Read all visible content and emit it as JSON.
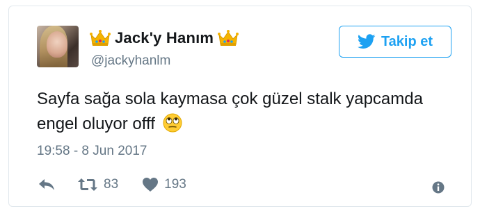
{
  "user": {
    "display_name": "Jack'y Hanım",
    "handle": "@jackyhanlm"
  },
  "follow_button": {
    "label": "Takip et",
    "icon": "twitter-bird-icon"
  },
  "tweet": {
    "text": "Sayfa sağa sola kaymasa çok güzel stalk yapcamda engel oluyor offf",
    "emoji": "face-with-rolling-eyes",
    "timestamp": "19:58 - 8 Jun 2017"
  },
  "actions": {
    "reply_icon": "reply-icon",
    "retweet_icon": "retweet-icon",
    "retweet_count": "83",
    "like_icon": "heart-icon",
    "like_count": "193",
    "info_icon": "info-icon"
  },
  "colors": {
    "accent": "#1da1f2",
    "text": "#14171a",
    "muted": "#657786",
    "border": "#e1e8ed"
  }
}
